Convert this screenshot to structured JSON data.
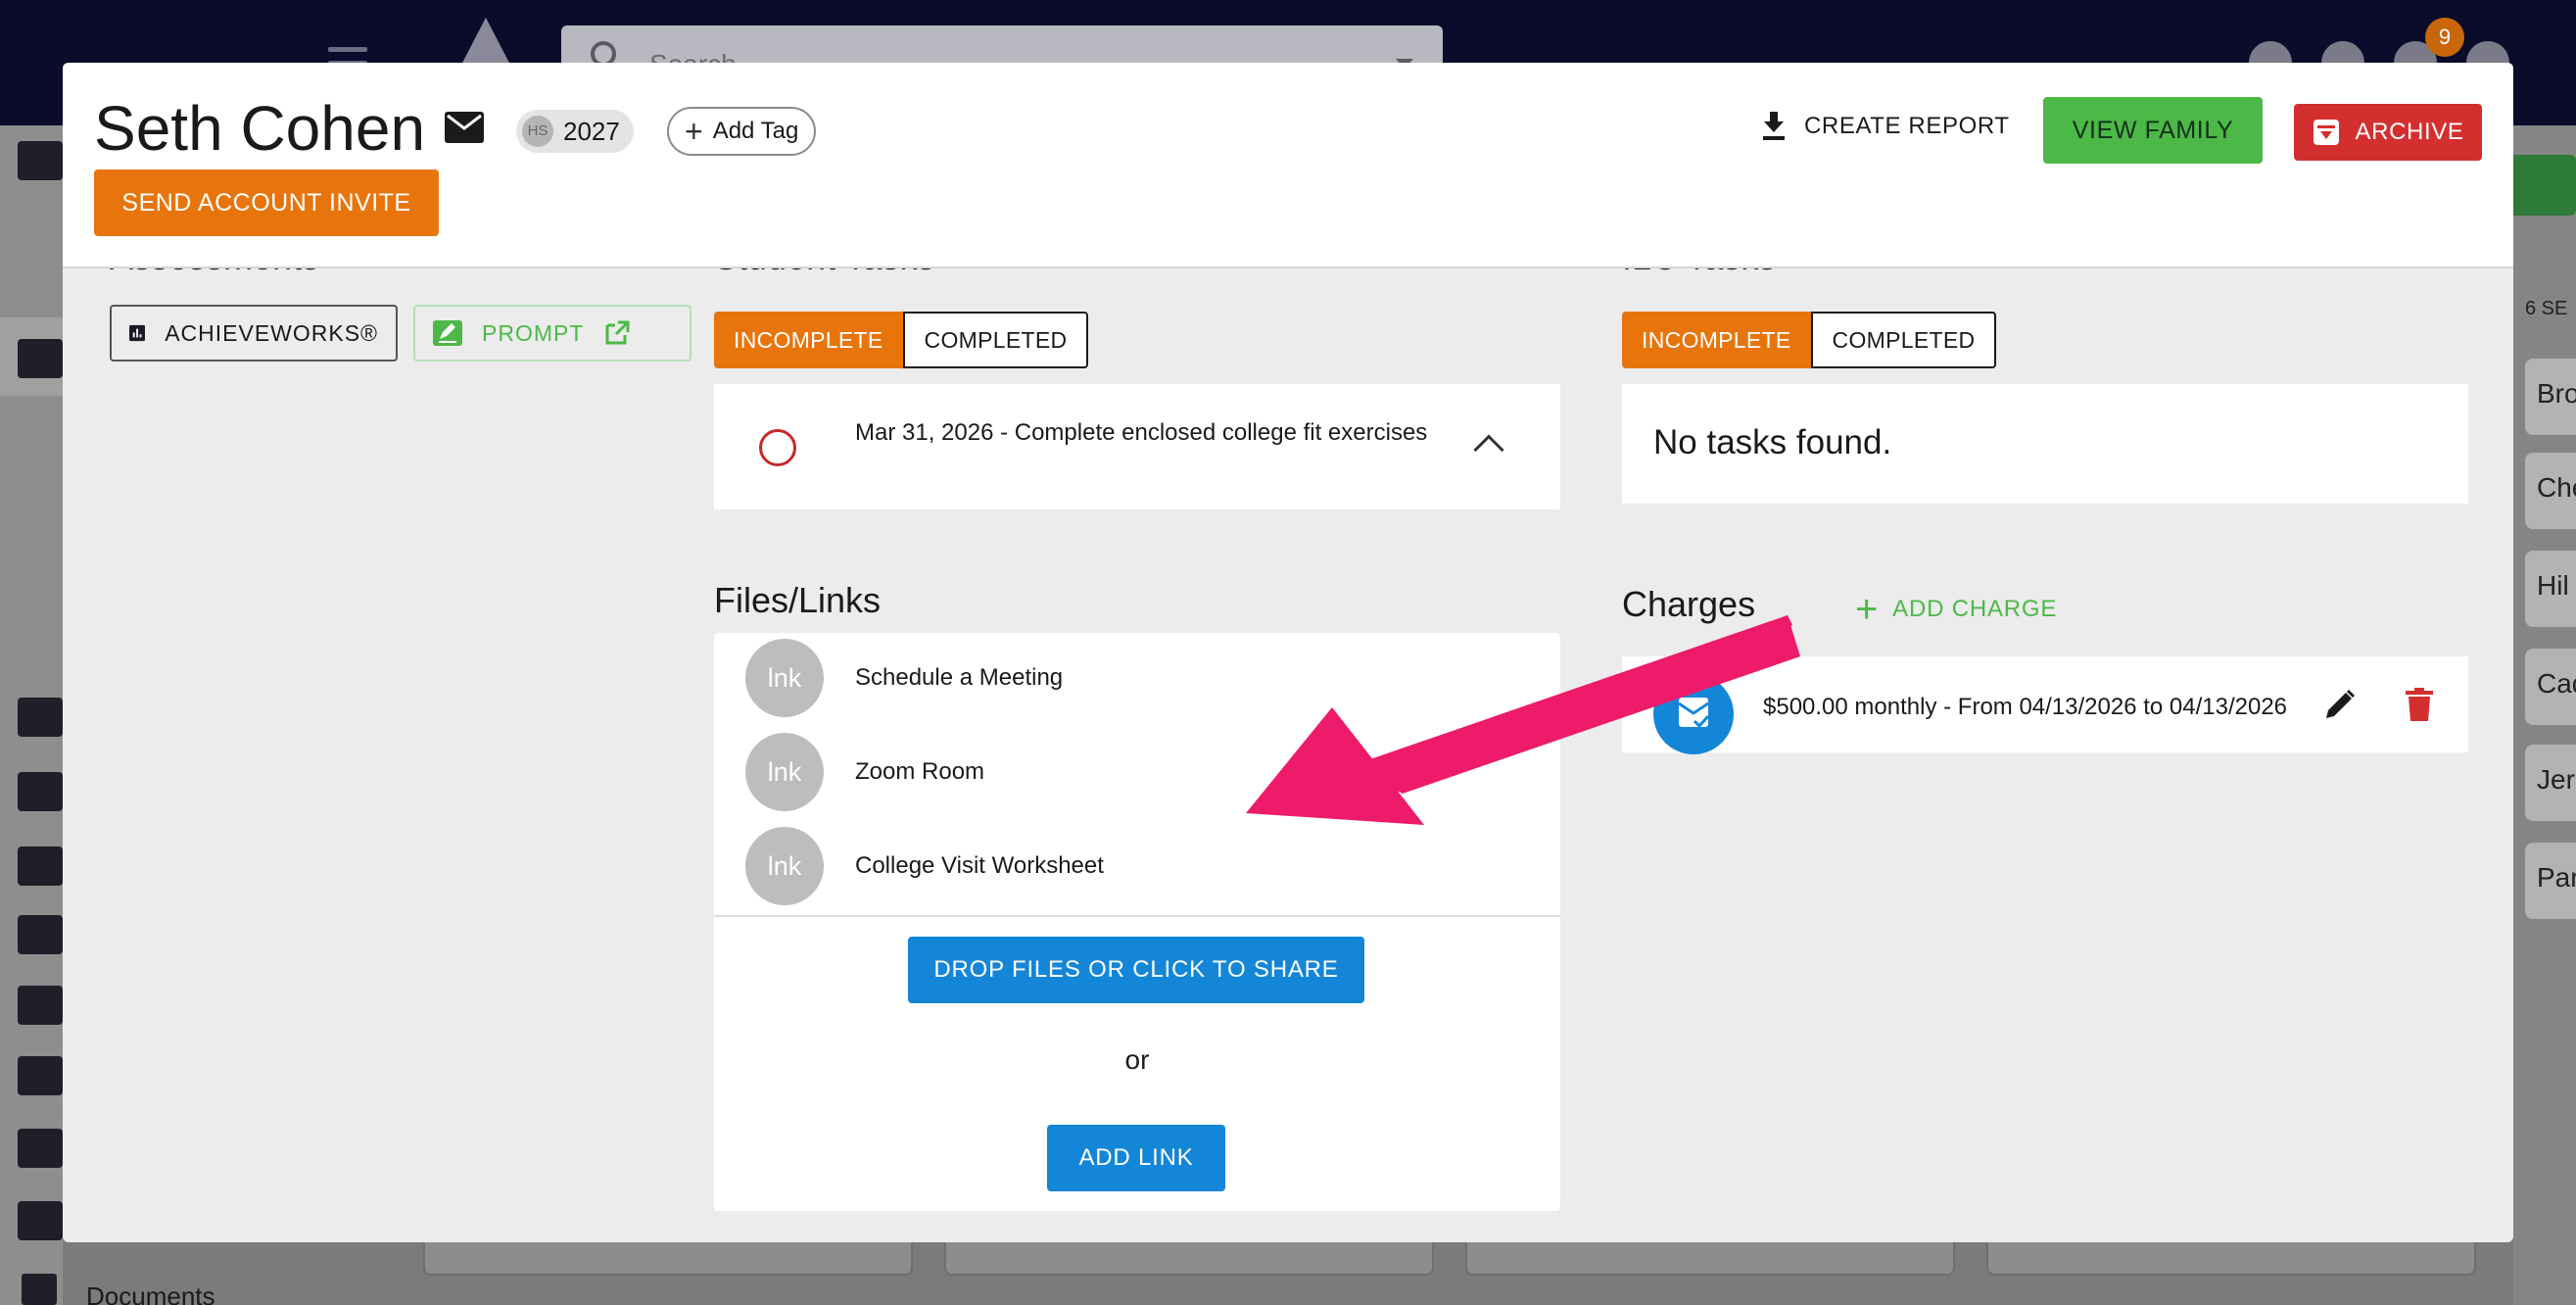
{
  "background": {
    "search_placeholder": "Search",
    "notification_count": "9",
    "sidebar_documents_label": "Documents",
    "right_panel_label": "6 SE",
    "right_panel_items": [
      "Bro",
      "Che",
      "Hil",
      "Cad",
      "Jer",
      "Par"
    ]
  },
  "header": {
    "student_name": "Seth Cohen",
    "grad_chip": {
      "avatar": "HS",
      "year": "2027"
    },
    "add_tag_label": "Add Tag",
    "send_invite_label": "SEND ACCOUNT INVITE",
    "create_report_label": "CREATE REPORT",
    "view_family_label": "VIEW FAMILY",
    "archive_label": "ARCHIVE"
  },
  "assessments": {
    "achieveworks_label": "ACHIEVEWORKS®",
    "prompt_label": "PROMPT"
  },
  "student_tasks": {
    "tabs": {
      "incomplete": "INCOMPLETE",
      "completed": "COMPLETED"
    },
    "items": [
      {
        "text": "Mar 31, 2026 - Complete enclosed college fit exercises"
      }
    ]
  },
  "ilc_tasks": {
    "tabs": {
      "incomplete": "INCOMPLETE",
      "completed": "COMPLETED"
    },
    "empty_message": "No tasks found."
  },
  "files": {
    "title": "Files/Links",
    "items": [
      {
        "avatar": "lnk",
        "label": "Schedule a Meeting"
      },
      {
        "avatar": "lnk",
        "label": "Zoom Room"
      },
      {
        "avatar": "lnk",
        "label": "College Visit Worksheet"
      }
    ],
    "drop_label": "DROP FILES OR CLICK TO SHARE",
    "or_label": "or",
    "add_link_label": "ADD LINK"
  },
  "charges": {
    "title": "Charges",
    "add_label": "ADD CHARGE",
    "items": [
      {
        "text": "$500.00 monthly - From 04/13/2026 to 04/13/2026"
      }
    ]
  },
  "colors": {
    "orange": "#e8750c",
    "green": "#4cb848",
    "red": "#d32f2f",
    "blue": "#1486d8",
    "annotation_pink": "#ee1a6a"
  }
}
